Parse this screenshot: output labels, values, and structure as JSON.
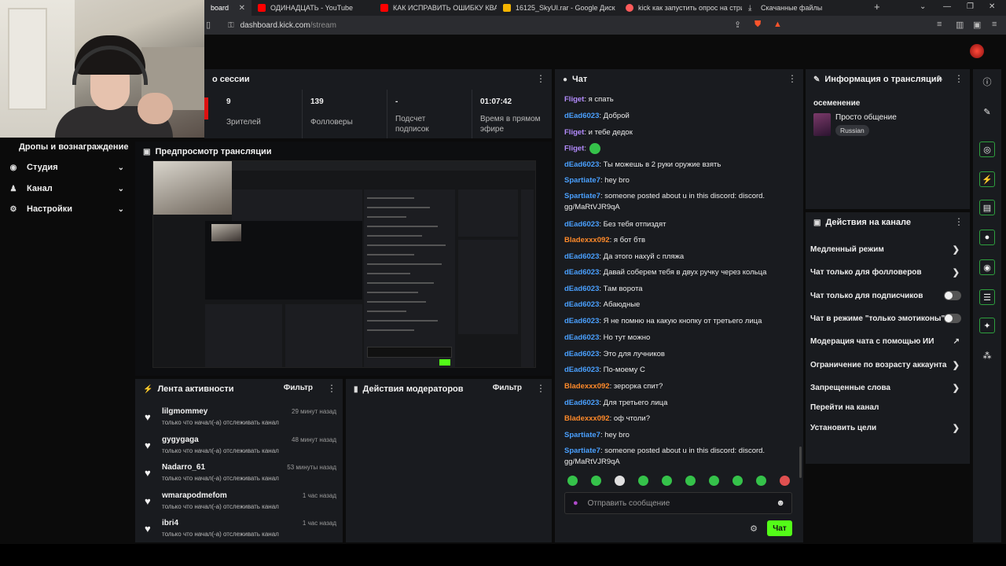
{
  "browser": {
    "tabs": [
      {
        "label": "board",
        "active": true,
        "color": "#53fc18"
      },
      {
        "label": "ОДИНАДЦАТЬ - YouTube",
        "color": "#ff0000"
      },
      {
        "label": "КАК ИСПРАВИТЬ ОШИБКУ КВАДРАТ",
        "color": "#ff0000"
      },
      {
        "label": "16125_SkyUI.rar - Google Диск",
        "color": "#f4b400"
      },
      {
        "label": "kick как запустить опрос на стриме",
        "color": "#ff5b5b"
      },
      {
        "label": "Скачанные файлы",
        "color": "#8ab4f8"
      }
    ],
    "new_tab": "+",
    "url_host": "dashboard.kick.com",
    "url_path": "/stream"
  },
  "sidebar": {
    "title": "Дропы и вознаграждение",
    "items": [
      {
        "label": "Студия",
        "icon": "broadcast-icon"
      },
      {
        "label": "Канал",
        "icon": "user-icon"
      },
      {
        "label": "Настройки",
        "icon": "gear-icon"
      }
    ]
  },
  "session": {
    "title": "о сессии",
    "stats": [
      {
        "value": "9",
        "label": "Зрителей"
      },
      {
        "value": "139",
        "label": "Фолловеры"
      },
      {
        "value": "-",
        "label": "Подсчет подписок"
      },
      {
        "value": "01:07:42",
        "label": "Время в прямом эфире"
      }
    ]
  },
  "preview": {
    "title": "Предпросмотр трансляции"
  },
  "activity": {
    "title": "Лента активности",
    "filter": "Фильтр",
    "items": [
      {
        "name": "lilgmommey",
        "desc": "только что начал(-а) отслеживать канал",
        "time": "29 минут назад"
      },
      {
        "name": "gygygaga",
        "desc": "только что начал(-а) отслеживать канал",
        "time": "48 минут назад"
      },
      {
        "name": "Nadarro_61",
        "desc": "только что начал(-а) отслеживать канал",
        "time": "53 минуты назад"
      },
      {
        "name": "wmarapodmefom",
        "desc": "только что начал(-а) отслеживать канал",
        "time": "1 час назад"
      },
      {
        "name": "ibri4",
        "desc": "только что начал(-а) отслеживать канал",
        "time": "1 час назад"
      }
    ]
  },
  "mod_actions": {
    "title": "Действия модераторов",
    "filter": "Фильтр"
  },
  "chat": {
    "title": "Чат",
    "messages": [
      {
        "user": "Fliget",
        "text": ": я спать",
        "color": "#b48cff"
      },
      {
        "user": "dEad6023",
        "text": ": Доброй",
        "color": "#4aa0ff"
      },
      {
        "user": "Fliget",
        "text": ": и тебе дедок",
        "color": "#b48cff"
      },
      {
        "user": "Fliget",
        "text": ":",
        "color": "#b48cff"
      },
      {
        "user": "dEad6023",
        "text": ": Ты можешь в 2 руки оружие взять",
        "color": "#4aa0ff"
      },
      {
        "user": "Spartiate7",
        "text": ": hey bro",
        "color": "#4aa0ff"
      },
      {
        "user": "Spartiate7",
        "text": ": someone posted about u in this discord: discord. gg/MaRtVJR9qA",
        "color": "#4aa0ff"
      },
      {
        "user": "dEad6023",
        "text": ": Без тебя отпиздят",
        "color": "#4aa0ff"
      },
      {
        "user": "Bladexxx092",
        "text": ": я бот бтв",
        "color": "#ff8a2a"
      },
      {
        "user": "dEad6023",
        "text": ": Да этого нахуй с пляжа",
        "color": "#4aa0ff"
      },
      {
        "user": "dEad6023",
        "text": ": Давай соберем тебя в двух ручку через кольца",
        "color": "#4aa0ff"
      },
      {
        "user": "dEad6023",
        "text": ": Там ворота",
        "color": "#4aa0ff"
      },
      {
        "user": "dEad6023",
        "text": ": Абаюдные",
        "color": "#4aa0ff"
      },
      {
        "user": "dEad6023",
        "text": ": Я не помню на какую кнопку от третьего лица",
        "color": "#4aa0ff"
      },
      {
        "user": "dEad6023",
        "text": ": Но тут можно",
        "color": "#4aa0ff"
      },
      {
        "user": "dEad6023",
        "text": ": Это для лучников",
        "color": "#4aa0ff"
      },
      {
        "user": "dEad6023",
        "text": ": По-моему С",
        "color": "#4aa0ff"
      },
      {
        "user": "Bladexxx092",
        "text": ": зерорка спит?",
        "color": "#ff8a2a"
      },
      {
        "user": "dEad6023",
        "text": ": Для третьего лица",
        "color": "#4aa0ff"
      },
      {
        "user": "Bladexxx092",
        "text": ": оф чтоли?",
        "color": "#ff8a2a"
      },
      {
        "user": "Spartiate7",
        "text": ": hey bro",
        "color": "#4aa0ff"
      },
      {
        "user": "Spartiate7",
        "text": ": someone posted about u in this discord: discord. gg/MaRtVJR9qA",
        "color": "#4aa0ff"
      }
    ],
    "input_placeholder": "Отправить сообщение",
    "send_label": "Чат"
  },
  "stream_info": {
    "title": "Информация о трансляции",
    "category": "осеменение",
    "stream_title": "Просто общение",
    "language": "Russian"
  },
  "channel_actions": {
    "title": "Действия на канале",
    "items": [
      {
        "label": "Медленный режим",
        "control": "chevron"
      },
      {
        "label": "Чат только для фолловеров",
        "control": "chevron"
      },
      {
        "label": "Чат только для подписчиков",
        "control": "toggle"
      },
      {
        "label": "Чат в режиме \"только эмотиконы\"",
        "control": "toggle"
      },
      {
        "label": "Модерация чата с помощью ИИ",
        "control": "external"
      },
      {
        "label": "Ограничение по возрасту аккаунта",
        "control": "chevron"
      },
      {
        "label": "Запрещенные слова",
        "control": "chevron"
      },
      {
        "label": "Перейти на канал",
        "control": "none"
      },
      {
        "label": "Установить цели",
        "control": "chevron"
      }
    ]
  },
  "colors": {
    "accent": "#53fc18",
    "live": "#dd1111"
  }
}
